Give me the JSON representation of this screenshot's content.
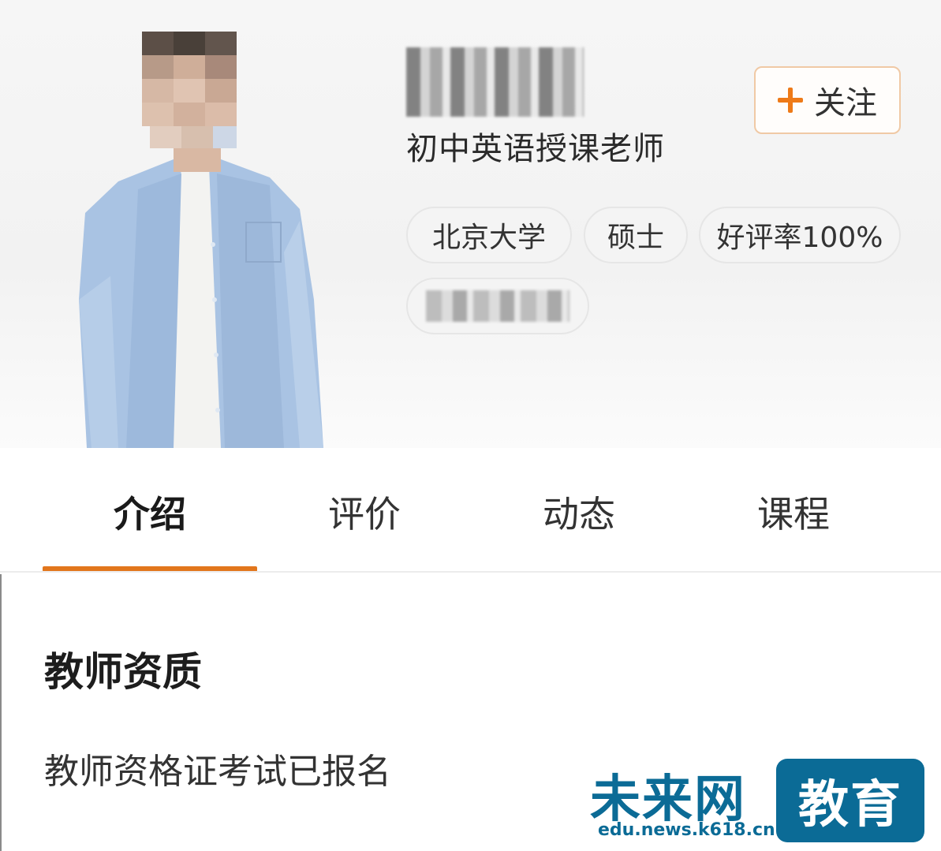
{
  "profile": {
    "subtitle": "初中英语授课老师",
    "follow_label": "关注",
    "tags": [
      "北京大学",
      "硕士",
      "好评率100%"
    ]
  },
  "tabs": [
    "介绍",
    "评价",
    "动态",
    "课程"
  ],
  "active_tab": "介绍",
  "section": {
    "title": "教师资质",
    "text": "教师资格证考试已报名"
  },
  "watermark": {
    "brand": "未来网",
    "badge": "教育",
    "url": "edu.news.k618.cn"
  },
  "colors": {
    "accent": "#e2761c",
    "watermark": "#0b6b96"
  }
}
